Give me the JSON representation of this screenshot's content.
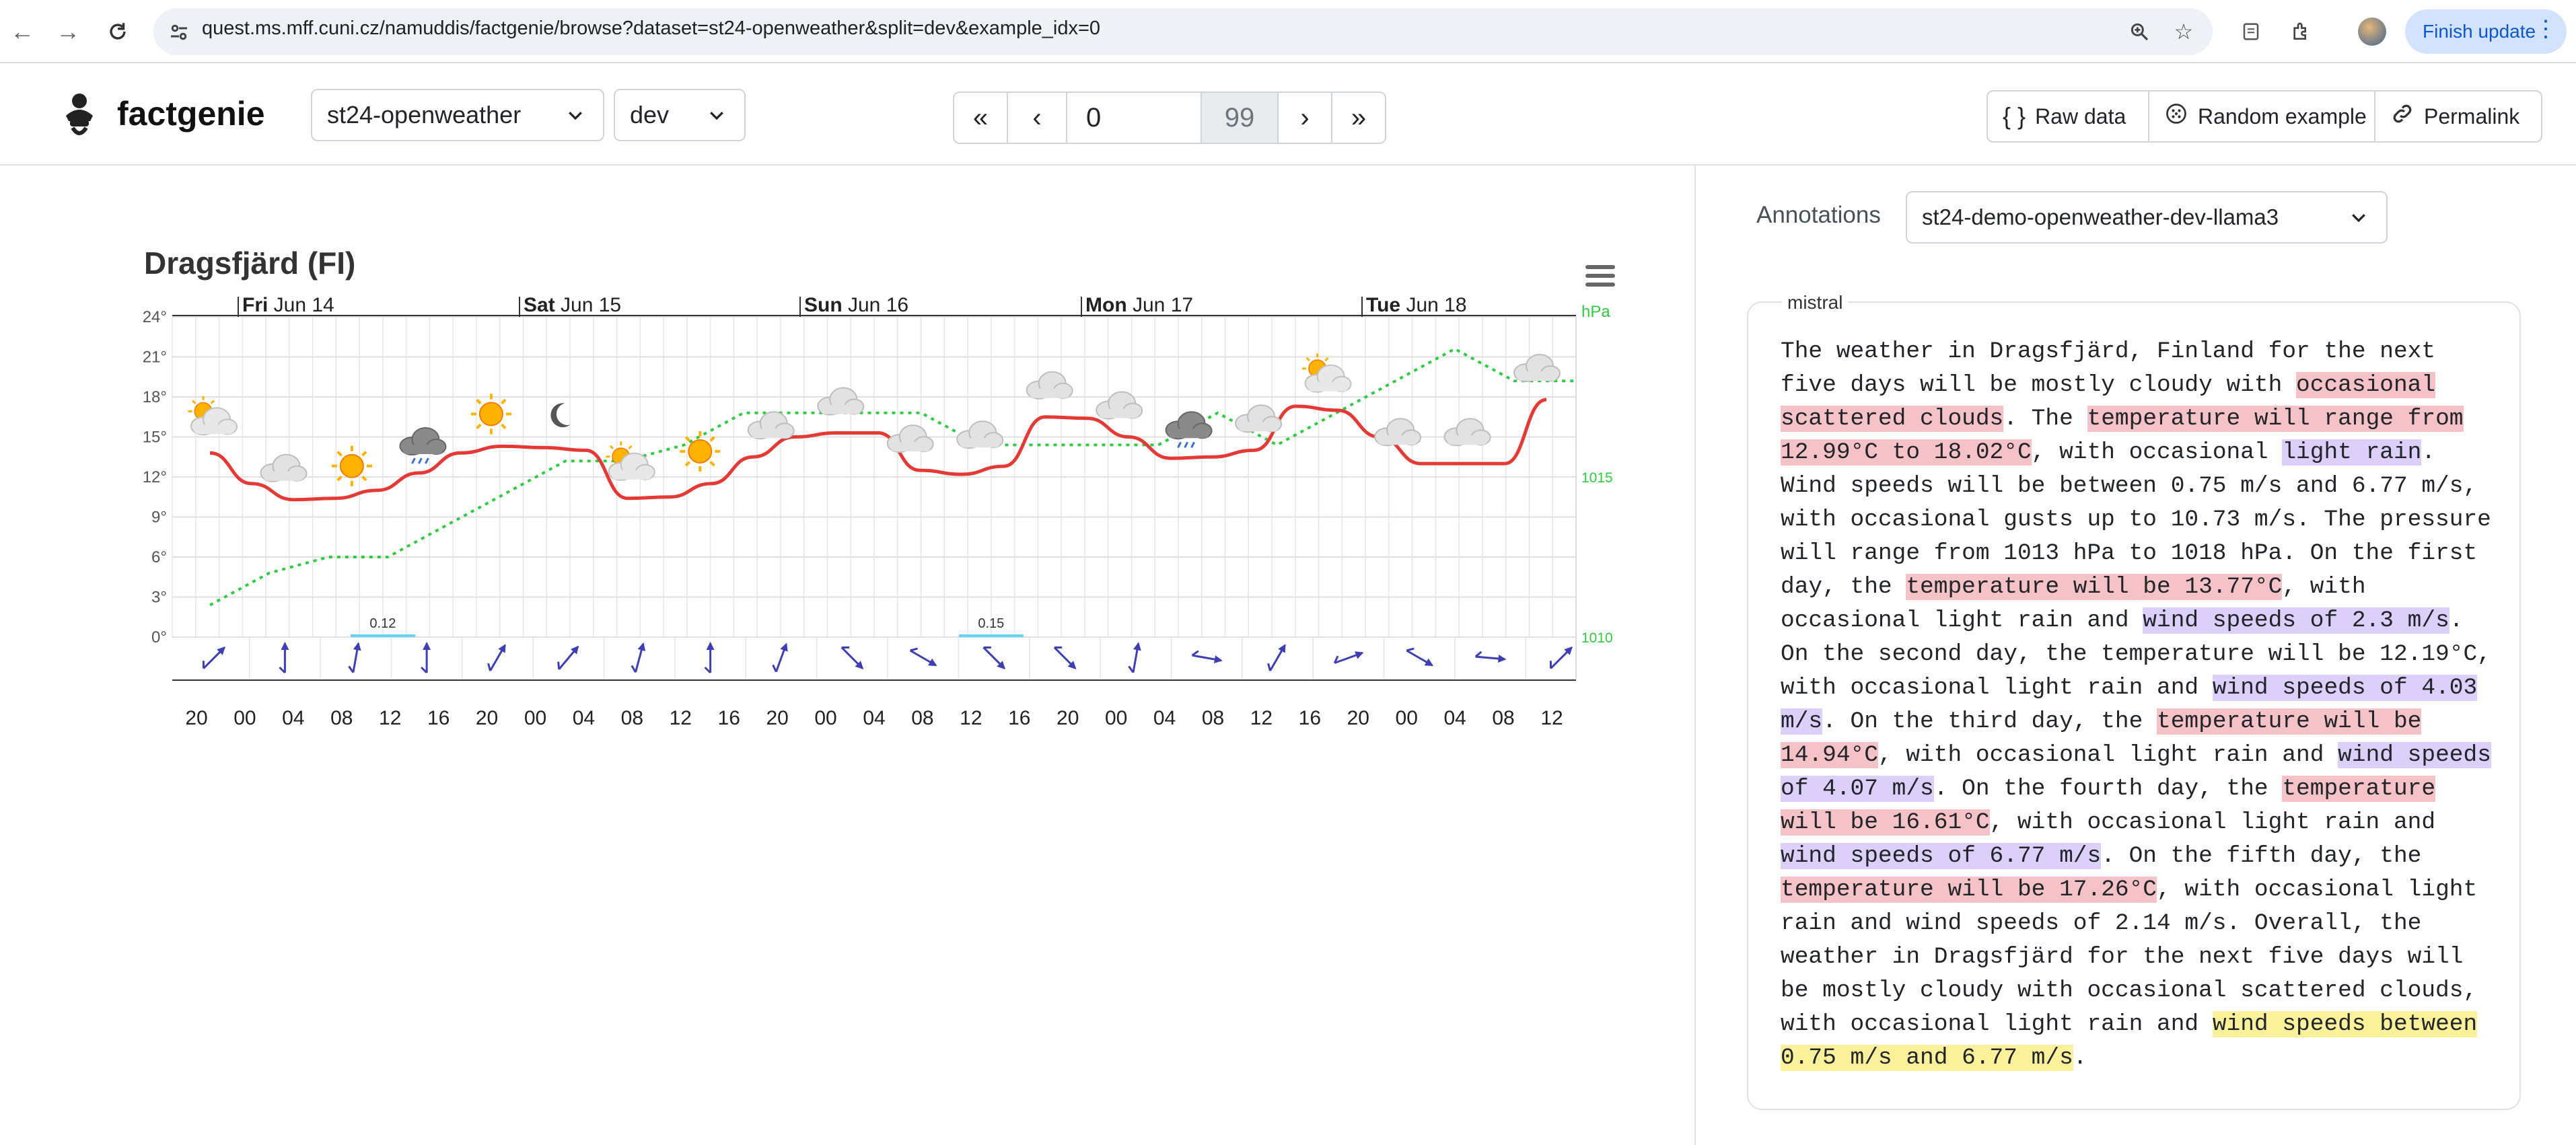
{
  "browser": {
    "url": "quest.ms.mff.cuni.cz/namuddis/factgenie/browse?dataset=st24-openweather&split=dev&example_idx=0",
    "finish_update_label": "Finish update"
  },
  "header": {
    "logo_text": "factgenie",
    "dataset": "st24-openweather",
    "split": "dev",
    "pager": {
      "first": "«",
      "prev": "‹",
      "current": "0",
      "total": "99",
      "next": "›",
      "last": "»"
    },
    "buttons": {
      "raw_data": "Raw data",
      "random_example": "Random example",
      "permalink": "Permalink"
    }
  },
  "annotations": {
    "label": "Annotations",
    "selected": "st24-demo-openweather-dev-llama3",
    "source": "mistral",
    "segments": [
      {
        "t": "The weather in Dragsfjärd, Finland for the next five days will be mostly cloudy with ",
        "c": ""
      },
      {
        "t": "occasional scattered clouds",
        "c": "red"
      },
      {
        "t": ". The ",
        "c": ""
      },
      {
        "t": "temperature will range from 12.99°C to 18.02°C",
        "c": "red"
      },
      {
        "t": ", with occasional ",
        "c": ""
      },
      {
        "t": "light rain",
        "c": "violet"
      },
      {
        "t": ". Wind speeds will be between 0.75 m/s and 6.77 m/s, with occasional gusts up to 10.73 m/s. The pressure will range from 1013 hPa to 1018 hPa. On the first day, the ",
        "c": ""
      },
      {
        "t": "temperature will be 13.77°C",
        "c": "red"
      },
      {
        "t": ", with occasional light rain and ",
        "c": ""
      },
      {
        "t": "wind speeds of 2.3 m/s",
        "c": "violet"
      },
      {
        "t": ". On the second day, the temperature will be 12.19°C, with occasional light rain and ",
        "c": ""
      },
      {
        "t": "wind speeds of 4.03 m/s",
        "c": "violet"
      },
      {
        "t": ". On the third day, the ",
        "c": ""
      },
      {
        "t": "temperature will be 14.94°C",
        "c": "red"
      },
      {
        "t": ", with occasional light rain and ",
        "c": ""
      },
      {
        "t": "wind speeds of 4.07 m/s",
        "c": "violet"
      },
      {
        "t": ". On the fourth day, the ",
        "c": ""
      },
      {
        "t": "temperature will be 16.61°C",
        "c": "red"
      },
      {
        "t": ", with occasional light rain and ",
        "c": ""
      },
      {
        "t": "wind speeds of 6.77 m/s",
        "c": "violet"
      },
      {
        "t": ". On the fifth day, the ",
        "c": ""
      },
      {
        "t": "temperature will be 17.26°C",
        "c": "red"
      },
      {
        "t": ", with occasional light rain and wind speeds of 2.14 m/s. Overall, the weather in Dragsfjärd for the next five days will be mostly cloudy with occasional scattered clouds, with occasional light rain and ",
        "c": ""
      },
      {
        "t": "wind speeds between 0.75 m/s and 6.77 m/s",
        "c": "yellow"
      },
      {
        "t": ".",
        "c": ""
      }
    ],
    "colors": {
      "red": "#f5c2c7",
      "violet": "#dcd0fb",
      "yellow": "#fbf19a"
    }
  },
  "chart_data": {
    "type": "line",
    "title": "Dragsfjärd (FI)",
    "day_labels": [
      {
        "day": "Fri",
        "date": "Jun 14"
      },
      {
        "day": "Sat",
        "date": "Jun 15"
      },
      {
        "day": "Sun",
        "date": "Jun 16"
      },
      {
        "day": "Mon",
        "date": "Jun 17"
      },
      {
        "day": "Tue",
        "date": "Jun 18"
      }
    ],
    "x_tick_labels": [
      "20",
      "00",
      "04",
      "08",
      "12",
      "16",
      "20",
      "00",
      "04",
      "08",
      "12",
      "16",
      "20",
      "00",
      "04",
      "08",
      "12",
      "16",
      "20",
      "00",
      "04",
      "08",
      "12",
      "16",
      "20",
      "00",
      "04",
      "08",
      "12"
    ],
    "y_ticks": [
      "24°",
      "21°",
      "18°",
      "15°",
      "12°",
      "9°",
      "6°",
      "3°",
      "0°"
    ],
    "ylim": [
      0,
      24
    ],
    "pressure_unit": "hPa",
    "pressure_ticks": [
      "1015",
      "1010"
    ],
    "pressure_lim": [
      1010,
      1020
    ],
    "temperature": [
      13.8,
      11.5,
      10.3,
      10.4,
      11.0,
      12.3,
      13.8,
      14.3,
      14.2,
      14.0,
      10.4,
      10.5,
      11.5,
      13.5,
      15.0,
      15.3,
      15.3,
      12.5,
      12.2,
      12.8,
      16.5,
      16.4,
      15.0,
      13.4,
      13.5,
      14.0,
      17.3,
      17.0,
      15.0,
      13.0,
      13.0,
      13.0,
      17.8
    ],
    "pressure": [
      1011.0,
      1012.0,
      1012.5,
      1012.5,
      1013.5,
      1014.5,
      1015.5,
      1015.5,
      1016.0,
      1017.0,
      1017.0,
      1017.0,
      1017.0,
      1016.0,
      1016.0,
      1016.0,
      1016.0,
      1017.0,
      1016.0,
      1017.0,
      1018.0,
      1019.0,
      1018.0,
      1018.0
    ],
    "precipitation": [
      {
        "label": "0.12",
        "index": 4
      },
      {
        "label": "0.15",
        "index": 17
      }
    ],
    "weather_icons": [
      "sun-cloud",
      "cloud",
      "sun",
      "rain",
      "sun",
      "moon",
      "sun-cloud",
      "sun",
      "cloud",
      "cloud",
      "cloud",
      "cloud",
      "cloud",
      "cloud",
      "rain",
      "cloud",
      "sun-cloud",
      "cloud",
      "cloud",
      "cloud"
    ],
    "wind_directions_deg": [
      45,
      0,
      10,
      0,
      30,
      40,
      15,
      0,
      20,
      135,
      120,
      135,
      135,
      10,
      100,
      30,
      70,
      120,
      95,
      45
    ],
    "series_colors": {
      "temperature": "#e53935",
      "pressure": "#2ecc40",
      "wind": "#3f3fb5",
      "precip": "#68cff8"
    }
  }
}
